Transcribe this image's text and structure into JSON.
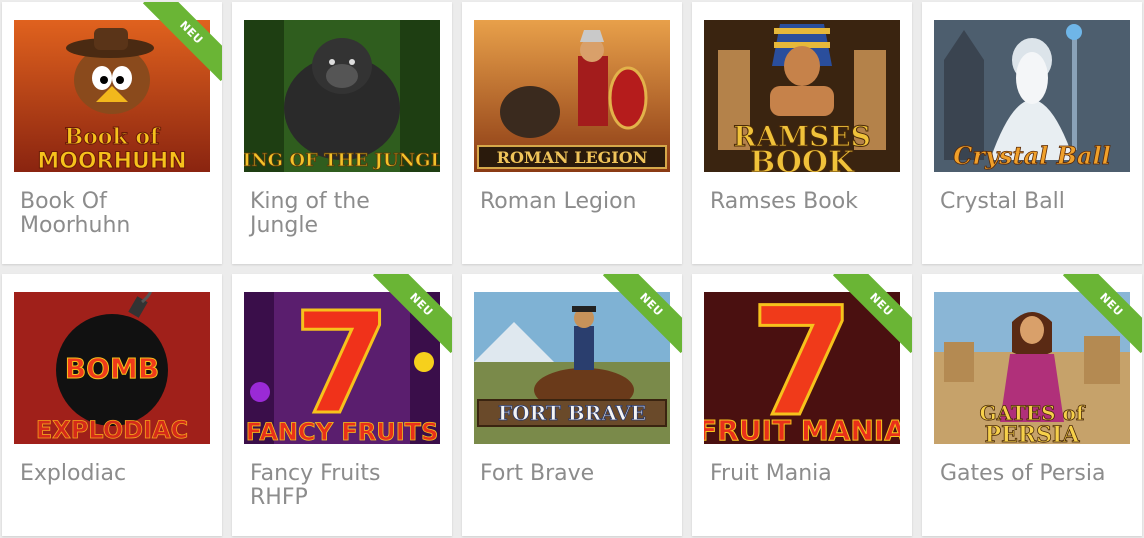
{
  "badge": {
    "new_label": "NEU",
    "color": "#6ab535"
  },
  "games": [
    {
      "title": "Book Of Moorhuhn",
      "logo": "Book of MOORHUHN",
      "new": true,
      "icon": "moorhuhn-chicken-icon",
      "bg": "#c2461a"
    },
    {
      "title": "King of the Jungle",
      "logo": "KING OF THE JUNGLE",
      "new": false,
      "icon": "gorilla-icon",
      "bg": "#2f5d1e"
    },
    {
      "title": "Roman Legion",
      "logo": "ROMAN LEGION",
      "new": false,
      "icon": "roman-soldier-icon",
      "bg": "#b65a24"
    },
    {
      "title": "Ramses Book",
      "logo": "RAMSES BOOK",
      "new": false,
      "icon": "pharaoh-icon",
      "bg": "#5a3a16"
    },
    {
      "title": "Crystal Ball",
      "logo": "Crystal Ball",
      "new": false,
      "icon": "wizard-icon",
      "bg": "#4d5e6e"
    },
    {
      "title": "Explodiac",
      "logo": "BOMB EXPLODIAC",
      "new": false,
      "icon": "bomb-icon",
      "bg": "#a0201a"
    },
    {
      "title": "Fancy Fruits RHFP",
      "logo": "FANCY FRUITS",
      "new": true,
      "icon": "seven-icon",
      "bg": "#5a1e6e"
    },
    {
      "title": "Fort Brave",
      "logo": "FORT BRAVE",
      "new": true,
      "icon": "cavalry-rider-icon",
      "bg": "#6fa3c4"
    },
    {
      "title": "Fruit Mania",
      "logo": "FRUIT MANIA",
      "new": true,
      "icon": "seven-icon",
      "bg": "#4a1010"
    },
    {
      "title": "Gates of Persia",
      "logo": "GATES of PERSIA",
      "new": true,
      "icon": "persian-princess-icon",
      "bg": "#7aa6c8"
    }
  ]
}
